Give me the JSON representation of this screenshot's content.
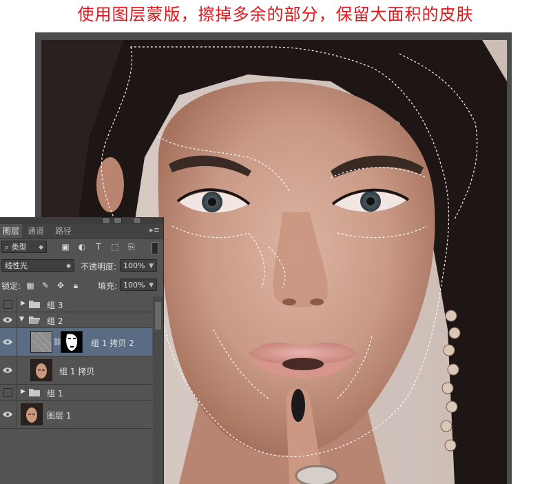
{
  "headline": "使用图层蒙版，擦掉多余的部分，保留大面积的皮肤",
  "accent_color": "#e8141a",
  "layers_panel": {
    "tabs": [
      "图层",
      "通道",
      "路径"
    ],
    "active_tab": "图层",
    "filter_label": "类型",
    "filter_icons": [
      "image-icon",
      "adjustment-icon",
      "type-icon",
      "shape-icon",
      "smart-object-icon"
    ],
    "blend_mode": "线性光",
    "opacity_label": "不透明度:",
    "opacity_value": "100%",
    "lock_label": "锁定:",
    "lock_icons": [
      "lock-transparent-icon",
      "lock-image-icon",
      "lock-position-icon",
      "lock-all-icon"
    ],
    "fill_label": "填充:",
    "fill_value": "100%",
    "layers": [
      {
        "name": "组 3",
        "kind": "group",
        "visible": false,
        "expanded": false
      },
      {
        "name": "组 2",
        "kind": "group",
        "visible": true,
        "expanded": true
      },
      {
        "name": "组 1 拷贝 2",
        "kind": "layer-with-mask",
        "visible": true,
        "selected": true
      },
      {
        "name": "组 1 拷贝",
        "kind": "layer",
        "visible": true
      },
      {
        "name": "组 1",
        "kind": "group",
        "visible": false,
        "expanded": false
      },
      {
        "name": "图层 1",
        "kind": "layer",
        "visible": true
      }
    ]
  }
}
